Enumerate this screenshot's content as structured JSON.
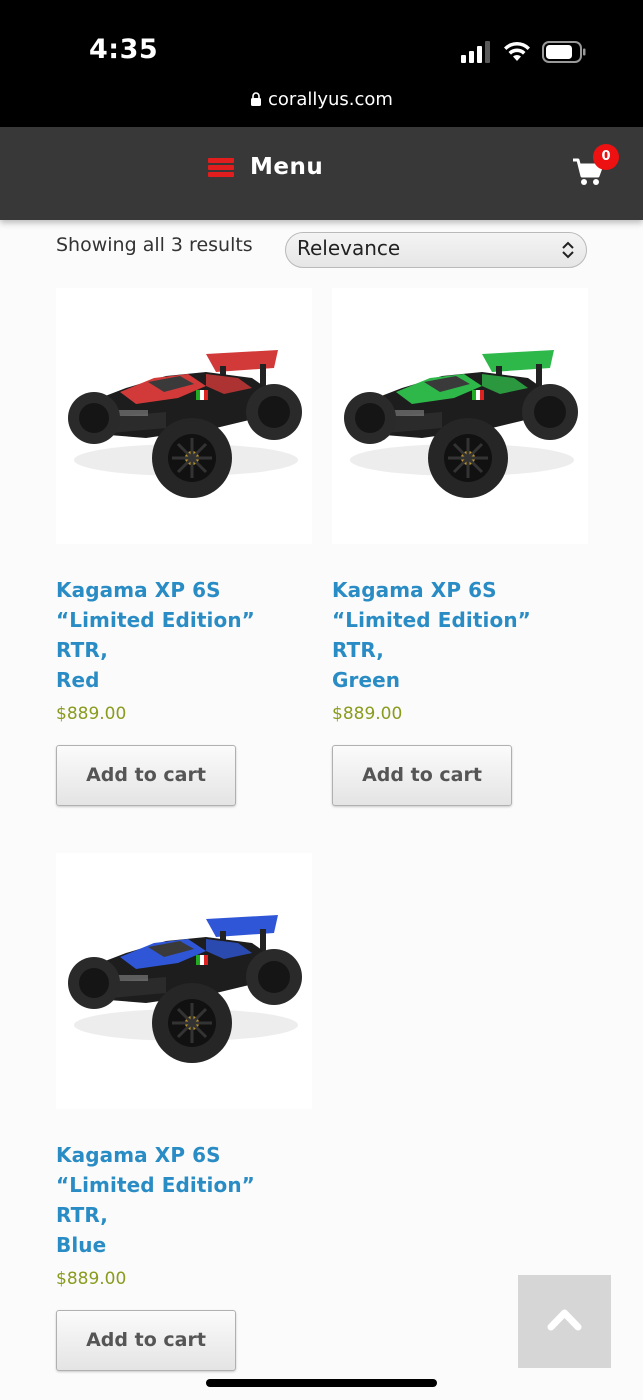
{
  "status_bar": {
    "time": "4:35"
  },
  "browser": {
    "url": "corallyus.com"
  },
  "nav": {
    "menu_label": "Menu",
    "cart_count": "0"
  },
  "shop": {
    "result_count": "Showing all 3 results",
    "sort_selected": "Relevance"
  },
  "products": [
    {
      "title_line1": "Kagama XP 6S",
      "title_line2": "“Limited Edition” RTR,",
      "title_line3": "Red",
      "price": "$889.00",
      "button": "Add to cart",
      "accent_color": "#d23a3a"
    },
    {
      "title_line1": "Kagama XP 6S",
      "title_line2": "“Limited Edition” RTR,",
      "title_line3": "Green",
      "price": "$889.00",
      "button": "Add to cart",
      "accent_color": "#2fb84a"
    },
    {
      "title_line1": "Kagama XP 6S",
      "title_line2": "“Limited Edition” RTR,",
      "title_line3": "Blue",
      "price": "$889.00",
      "button": "Add to cart",
      "accent_color": "#2f56d6"
    }
  ],
  "colors": {
    "link": "#2a8cc4",
    "price": "#8a9b1e",
    "nav_bg": "#383838",
    "brand_red": "#e11d1d"
  },
  "icons": {
    "menu": "hamburger-icon",
    "cart": "shopping-cart-icon",
    "back_to_top": "chevron-up-icon",
    "lock": "lock-icon"
  }
}
